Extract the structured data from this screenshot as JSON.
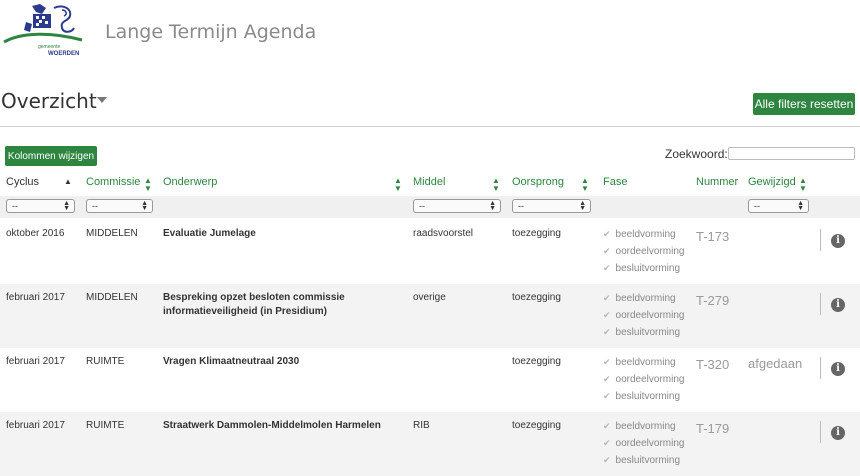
{
  "header": {
    "app_title": "Lange Termijn Agenda",
    "logo_text_small": "gemeente",
    "logo_text_big": "WOERDEN"
  },
  "page": {
    "heading": "Overzicht",
    "reset_filters_label": "Alle filters resetten",
    "columns_button_label": "Kolommen wijzigen",
    "search_label": "Zoekwoord:",
    "search_value": ""
  },
  "colors": {
    "accent": "#2e8540",
    "row_alt": "#f3f3f3",
    "muted": "#9a9a9a"
  },
  "columns": [
    "Cyclus",
    "Commissie",
    "Onderwerp",
    "Middel",
    "Oorsprong",
    "Fase",
    "Nummer",
    "Gewijzigd"
  ],
  "filter_default": "--",
  "rows": [
    {
      "cyclus": "oktober 2016",
      "commissie": "MIDDELEN",
      "onderwerp_1": "Evaluatie Jumelage",
      "onderwerp_2": "",
      "middel": "raadsvoorstel",
      "oorsprong": "toezegging",
      "fase": [
        "beeldvorming",
        "oordeelvorming",
        "besluitvorming"
      ],
      "nummer": "T-173",
      "gewijzigd": ""
    },
    {
      "cyclus": "februari 2017",
      "commissie": "MIDDELEN",
      "onderwerp_1": "Bespreking opzet besloten commissie",
      "onderwerp_2": "informatieveiligheid (in Presidium)",
      "middel": "overige",
      "oorsprong": "toezegging",
      "fase": [
        "beeldvorming",
        "oordeelvorming",
        "besluitvorming"
      ],
      "nummer": "T-279",
      "gewijzigd": ""
    },
    {
      "cyclus": "februari 2017",
      "commissie": "RUIMTE",
      "onderwerp_1": "Vragen Klimaatneutraal 2030",
      "onderwerp_2": "",
      "middel": "",
      "oorsprong": "toezegging",
      "fase": [
        "beeldvorming",
        "oordeelvorming",
        "besluitvorming"
      ],
      "nummer": "T-320",
      "gewijzigd": "afgedaan"
    },
    {
      "cyclus": "februari 2017",
      "commissie": "RUIMTE",
      "onderwerp_1": "Straatwerk Dammolen-Middelmolen Harmelen",
      "onderwerp_2": "",
      "middel": "RIB",
      "oorsprong": "toezegging",
      "fase": [
        "beeldvorming",
        "oordeelvorming",
        "besluitvorming"
      ],
      "nummer": "T-179",
      "gewijzigd": ""
    }
  ]
}
